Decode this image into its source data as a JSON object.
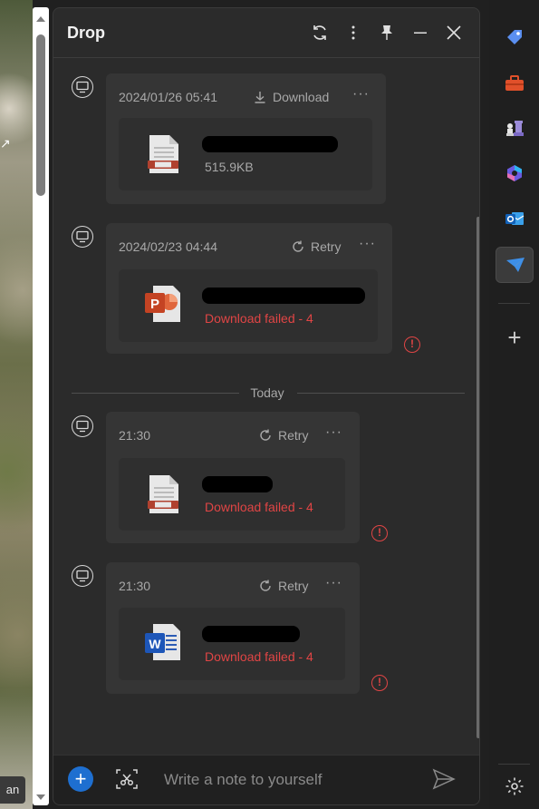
{
  "background": {
    "corner_label": "an"
  },
  "panel": {
    "title": "Drop",
    "header_buttons": [
      "refresh-icon",
      "more-vertical-icon",
      "pin-icon",
      "minimize-icon",
      "close-icon"
    ]
  },
  "messages": [
    {
      "timestamp": "2024/01/26 05:41",
      "action_label": "Download",
      "action_icon": "download-icon",
      "file_type": "generic",
      "file_info": "515.9KB",
      "status": "ok"
    },
    {
      "timestamp": "2024/02/23 04:44",
      "action_label": "Retry",
      "action_icon": "retry-icon",
      "file_type": "powerpoint",
      "file_info": "Download failed - 4",
      "status": "failed"
    },
    {
      "timestamp": "21:30",
      "action_label": "Retry",
      "action_icon": "retry-icon",
      "file_type": "generic",
      "file_info": "Download failed - 4",
      "status": "failed"
    },
    {
      "timestamp": "21:30",
      "action_label": "Retry",
      "action_icon": "retry-icon",
      "file_type": "word",
      "file_info": "Download failed - 4",
      "status": "failed"
    }
  ],
  "divider_label": "Today",
  "more_label": "···",
  "error_glyph": "!",
  "composer": {
    "add_label": "+",
    "placeholder": "Write a note to yourself"
  },
  "sidebar": {
    "items": [
      "tag-icon",
      "toolbox-icon",
      "chess-icon",
      "copilot-icon",
      "outlook-icon",
      "drop-icon"
    ],
    "active": "drop-icon",
    "add_label": "+",
    "settings": "settings-icon"
  },
  "colors": {
    "accent": "#1e6fd0",
    "error": "#e04545",
    "panel_bg": "#2b2b2b",
    "card_bg": "#353535"
  }
}
